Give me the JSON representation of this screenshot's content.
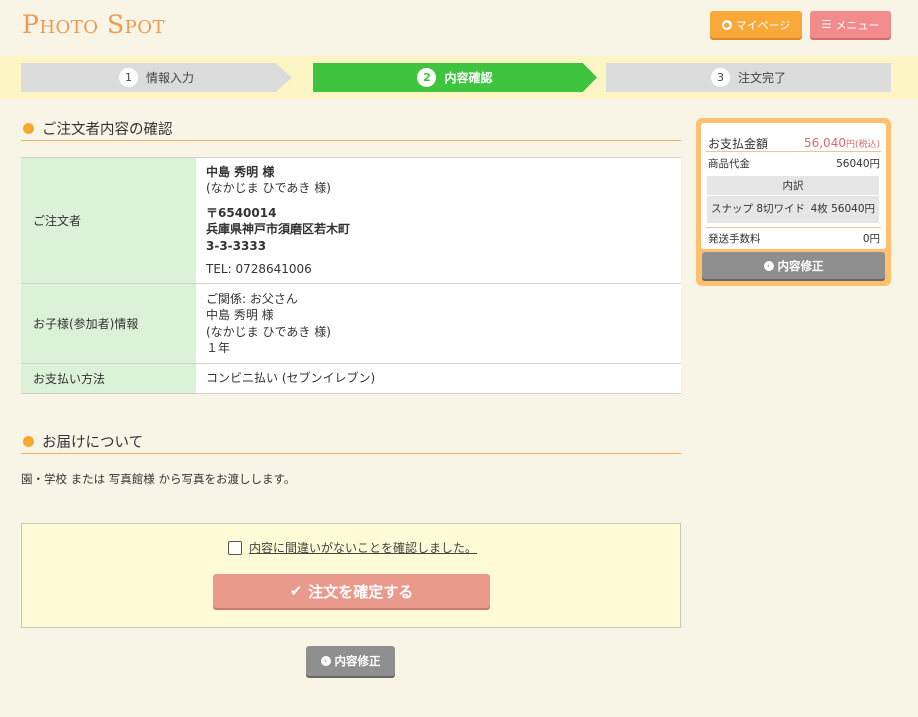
{
  "header": {
    "logo": "Photo Spot",
    "mypage_label": "マイページ",
    "menu_label": "メニュー"
  },
  "steps": [
    {
      "num": "1",
      "label": "情報入力"
    },
    {
      "num": "2",
      "label": "内容確認"
    },
    {
      "num": "3",
      "label": "注文完了"
    }
  ],
  "orderer_section": {
    "title": "ご注文者内容の確認",
    "rows": {
      "orderer": {
        "label": "ご注文者",
        "name": "中島 秀明 様",
        "kana": "(なかじま ひであき 様)",
        "postal": "〒6540014",
        "address1": "兵庫県神戸市須磨区若木町",
        "address2": "3-3-3333",
        "tel": "TEL: 0728641006"
      },
      "child": {
        "label": "お子様(参加者)情報",
        "relation": "ご関係: お父さん",
        "name": "中島 秀明 様",
        "kana": "(なかじま ひであき 様)",
        "grade": "１年"
      },
      "payment": {
        "label": "お支払い方法",
        "value": "コンビニ払い (セブンイレブン)"
      }
    }
  },
  "delivery_section": {
    "title": "お届けについて",
    "text": "園・学校 または 写真館様 から写真をお渡しします。"
  },
  "confirm": {
    "checkbox_label": "内容に間違いがないことを確認しました。",
    "checked": false,
    "submit_label": "注文を確定する",
    "back_label": "内容修正"
  },
  "summary": {
    "total_label": "お支払金額",
    "total_value": "56,040",
    "total_unit": "円(税込)",
    "product_label": "商品代金",
    "product_value": "56040円",
    "breakdown_label": "内訳",
    "breakdown_item": "スナップ 8切ワイド",
    "breakdown_qty_price": "4枚 56040円",
    "shipping_label": "発送手数料",
    "shipping_value": "0円",
    "back_label": "内容修正"
  },
  "colors": {
    "accent_orange": "#f9a83a",
    "menu_red": "#f28c8c",
    "active_step_green": "#3ec43e",
    "table_header_green": "#dcf2d8",
    "submit_salmon": "#e99a8d"
  }
}
